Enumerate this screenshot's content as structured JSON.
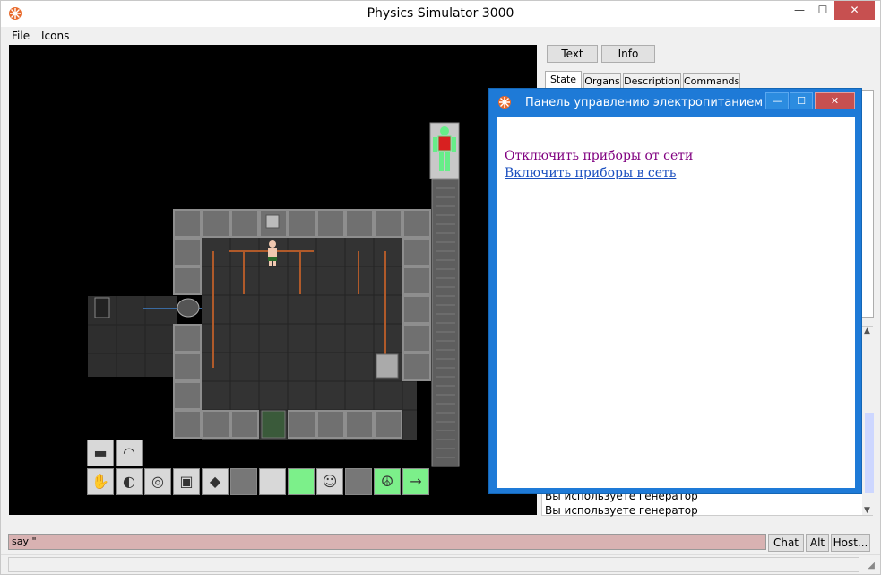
{
  "window": {
    "title": "Physics Simulator 3000",
    "min_label": "—",
    "max_label": "☐",
    "close_label": "✕"
  },
  "menu": {
    "file": "File",
    "icons": "Icons"
  },
  "right_pane": {
    "text_button": "Text",
    "info_button": "Info",
    "tabs": [
      "State",
      "Organs",
      "Description",
      "Commands"
    ],
    "output_lines": [
      "Вы используете генератор",
      "Вы используете генератор"
    ]
  },
  "command_bar": {
    "input_value": "say \"",
    "chat_button": "Chat",
    "alt_button": "Alt",
    "host_button": "Host..."
  },
  "popup": {
    "title": "Панель управлению электропитанием",
    "link_disconnect": "Отключить приборы от сети",
    "link_connect": "Включить приборы в сеть",
    "min_label": "—",
    "max_label": "☐",
    "close_label": "✕"
  },
  "colors": {
    "popup_border": "#1e7ad7",
    "link_visited": "#800080",
    "link_normal": "#0000ee",
    "command_input_bg": "#d8b2b2",
    "hud_green": "#7cf08a"
  }
}
